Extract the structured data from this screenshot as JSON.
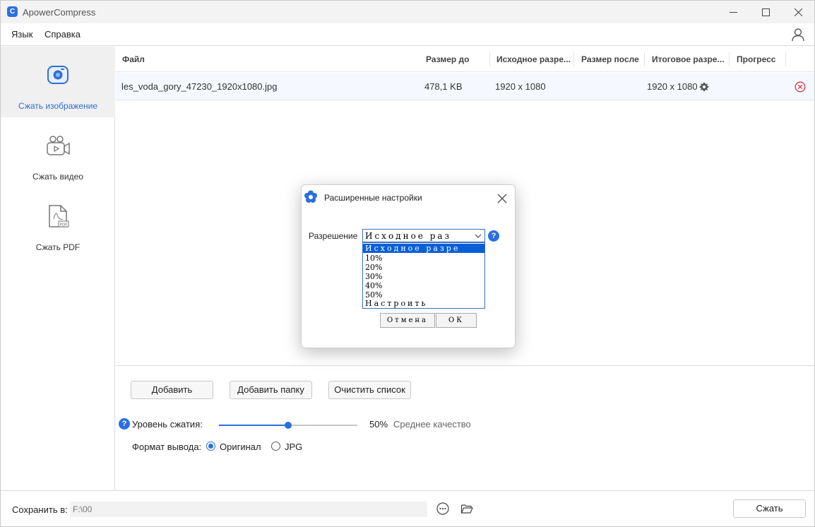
{
  "app": {
    "title": "ApowerCompress",
    "icon_letter": "C"
  },
  "menu": {
    "language": "Язык",
    "help": "Справка"
  },
  "sidebar": {
    "items": [
      {
        "label": "Сжать изображение",
        "icon": "camera-icon",
        "active": true
      },
      {
        "label": "Сжать видео",
        "icon": "video-camera-icon",
        "active": false
      },
      {
        "label": "Сжать PDF",
        "icon": "pdf-file-icon",
        "active": false
      }
    ]
  },
  "table": {
    "columns": [
      "Файл",
      "Размер до",
      "Исходное разре...",
      "Размер после",
      "Итоговое разре...",
      "Прогресс"
    ],
    "rows": [
      {
        "file": "les_voda_gory_47230_1920x1080.jpg",
        "size_before": "478,1 KB",
        "orig_res": "1920 x 1080",
        "size_after": "",
        "final_res": "1920 x 1080",
        "progress": ""
      }
    ]
  },
  "controls": {
    "add": "Добавить",
    "add_folder": "Добавить папку",
    "clear": "Очистить список",
    "compression_label": "Уровень сжатия:",
    "compression_value": 50,
    "compression_percent": "50%",
    "quality": "Среднее качество",
    "format_label": "Формат вывода:",
    "format_original": "Оригинал",
    "format_jpg": "JPG",
    "help_glyph": "?"
  },
  "footer": {
    "save_label": "Сохранить в:",
    "path": "F:\\00",
    "compress": "Сжать"
  },
  "dialog": {
    "title": "Расширенные настройки",
    "resolution_label": "Разрешение",
    "selected": "Исходное раз",
    "options": [
      "Исходное разре",
      "10%",
      "20%",
      "30%",
      "40%",
      "50%",
      "Настроить"
    ],
    "cancel": "Отмена",
    "ok": "ОК",
    "help_glyph": "?"
  },
  "colors": {
    "accent": "#2a6fe0",
    "sidebar_active_text": "#2f6fd6",
    "remove_red": "#d9343b"
  }
}
